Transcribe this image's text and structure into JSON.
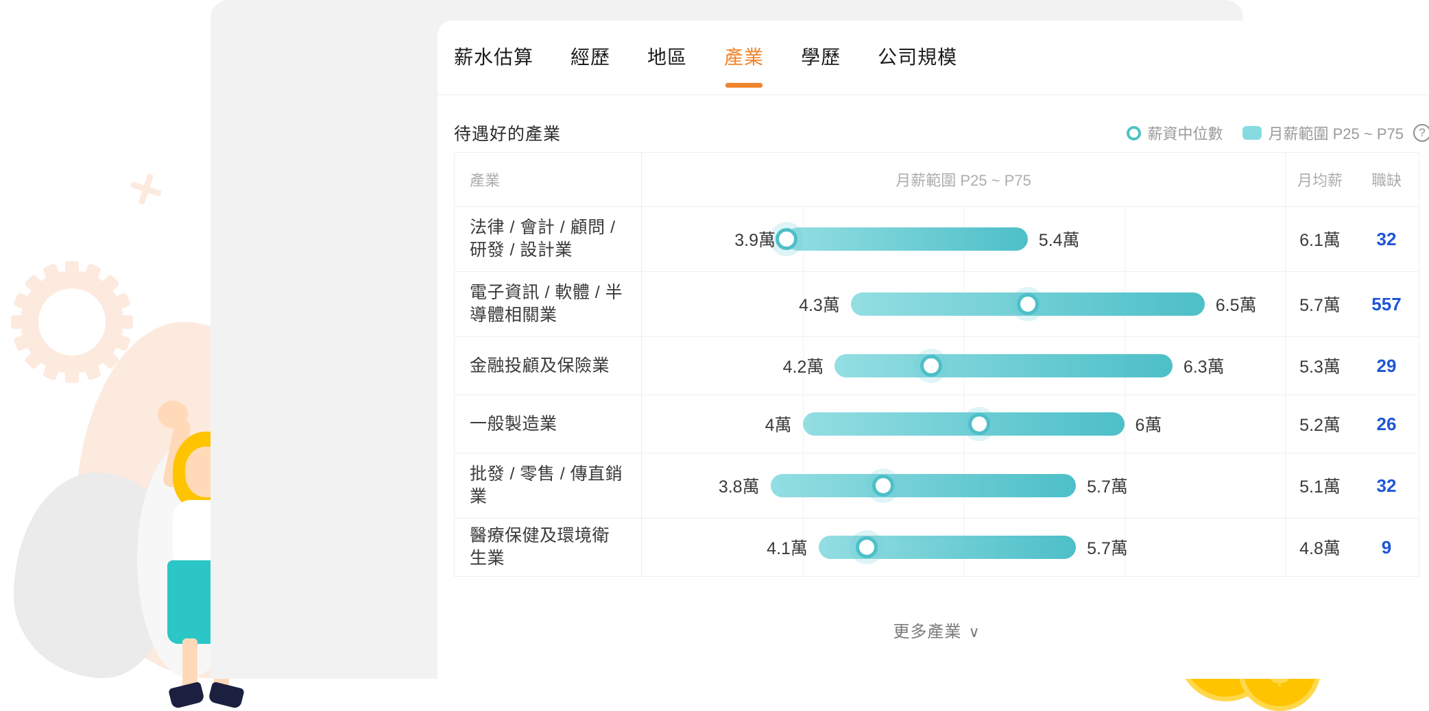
{
  "tabs": [
    {
      "label": "薪水估算",
      "active": false
    },
    {
      "label": "經歷",
      "active": false
    },
    {
      "label": "地區",
      "active": false
    },
    {
      "label": "產業",
      "active": true
    },
    {
      "label": "學歷",
      "active": false
    },
    {
      "label": "公司規模",
      "active": false
    }
  ],
  "section": {
    "title": "待遇好的產業",
    "legend_median": "薪資中位數",
    "legend_range": "月薪範圍 P25 ~ P75",
    "help_icon": "?"
  },
  "table": {
    "headers": [
      "產業",
      "月薪範圍 P25 ~ P75",
      "月均薪",
      "職缺"
    ]
  },
  "footer": {
    "more_label": "更多產業",
    "chevron": "∨"
  },
  "colors": {
    "accent_orange": "#f1852e",
    "bar_light": "#93dee2",
    "bar_dark": "#4dbfc8",
    "job_link": "#1e56d6",
    "muted": "#adadad"
  },
  "chart_data": {
    "type": "bar",
    "title": "待遇好的產業",
    "subtitle": "月薪範圍 P25 ~ P75",
    "xlabel": "",
    "ylabel": "產業",
    "unit": "萬",
    "xlim": [
      3.0,
      7.0
    ],
    "grid": true,
    "legend": [
      "薪資中位數",
      "月薪範圍 P25 ~ P75"
    ],
    "legend_position": "top-right",
    "columns": [
      "產業",
      "月薪範圍 P25 ~ P75",
      "月均薪",
      "職缺"
    ],
    "categories": [
      "法律 / 會計 / 顧問 / 研發 / 設計業",
      "電子資訊 / 軟體 / 半導體相關業",
      "金融投顧及保險業",
      "一般製造業",
      "批發 / 零售 / 傳直銷業",
      "醫療保健及環境衛生業"
    ],
    "rows": [
      {
        "name": "法律 / 會計 / 顧問 / 研發 / 設計業",
        "p25": 3.9,
        "p75": 5.4,
        "median": 3.9,
        "p25_label": "3.9萬",
        "p75_label": "5.4萬",
        "avg": "6.1萬",
        "jobs": "32"
      },
      {
        "name": "電子資訊 / 軟體 / 半導體相關業",
        "p25": 4.3,
        "p75": 6.5,
        "median": 5.4,
        "p25_label": "4.3萬",
        "p75_label": "6.5萬",
        "avg": "5.7萬",
        "jobs": "557"
      },
      {
        "name": "金融投顧及保險業",
        "p25": 4.2,
        "p75": 6.3,
        "median": 4.8,
        "p25_label": "4.2萬",
        "p75_label": "6.3萬",
        "avg": "5.3萬",
        "jobs": "29"
      },
      {
        "name": "一般製造業",
        "p25": 4.0,
        "p75": 6.0,
        "median": 5.1,
        "p25_label": "4萬",
        "p75_label": "6萬",
        "avg": "5.2萬",
        "jobs": "26"
      },
      {
        "name": "批發 / 零售 / 傳直銷業",
        "p25": 3.8,
        "p75": 5.7,
        "median": 4.5,
        "p25_label": "3.8萬",
        "p75_label": "5.7萬",
        "avg": "5.1萬",
        "jobs": "32"
      },
      {
        "name": "醫療保健及環境衛生業",
        "p25": 4.1,
        "p75": 5.7,
        "median": 4.4,
        "p25_label": "4.1萬",
        "p75_label": "5.7萬",
        "avg": "4.8萬",
        "jobs": "9"
      }
    ]
  }
}
